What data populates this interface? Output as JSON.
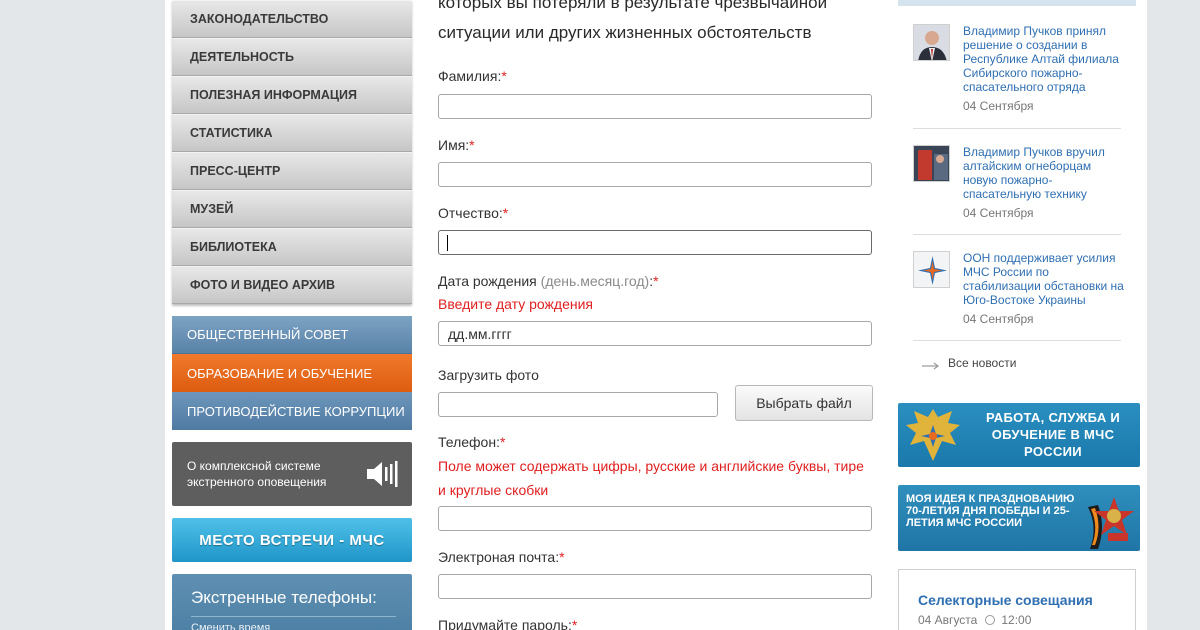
{
  "left_menu": {
    "gray_items": [
      {
        "label": "Законодательство"
      },
      {
        "label": "Деятельность"
      },
      {
        "label": "Полезная информация"
      },
      {
        "label": "Статистика"
      },
      {
        "label": "Пресс-центр"
      },
      {
        "label": "Музей"
      },
      {
        "label": "Библиотека"
      },
      {
        "label": "Фото и видео архив"
      }
    ],
    "color_items": [
      {
        "label": "Общественный совет"
      },
      {
        "label": "Образование и обучение"
      },
      {
        "label": "Противодействие коррупции"
      }
    ],
    "alert_system": {
      "text": "О комплексной системе экстренного оповещения",
      "icon": "speaker-icon"
    },
    "meeting_banner": {
      "text": "МЕСТО ВСТРЕЧИ - МЧС"
    },
    "emergency_phones": {
      "title": "Экстренные телефоны:",
      "subtitle": "Сменить время"
    }
  },
  "form": {
    "intro_line1": "которых вы потеряли в результате чрезвычайной",
    "intro_line2": "ситуации или других жизненных обстоятельств",
    "required_mark": "*",
    "surname": {
      "label": "Фамилия:",
      "value": ""
    },
    "name": {
      "label": "Имя:",
      "value": ""
    },
    "patronymic": {
      "label": "Отчество:",
      "value": ""
    },
    "birthdate": {
      "label": "Дата рождения",
      "hint": "(день.месяц.год)",
      "colon": ":",
      "error": "Введите дату рождения",
      "placeholder": "дд.мм.гггг"
    },
    "photo": {
      "label": "Загрузить фото",
      "button": "Выбрать файл"
    },
    "phone": {
      "label": "Телефон:",
      "error_line1": "Поле может содержать цифры, русские и английские буквы, тире",
      "error_line2": "и круглые скобки"
    },
    "email": {
      "label": "Электроная почта:"
    },
    "password": {
      "label": "Придумайте пароль:"
    }
  },
  "news": {
    "items": [
      {
        "title": "Владимир Пучков принял решение о создании в Республике Алтай филиала Сибирского пожарно-спасательного отряда",
        "date": "04 Сентября"
      },
      {
        "title": "Владимир Пучков вручил алтайским огнеборцам новую пожарно-спасательную технику",
        "date": "04 Сентября"
      },
      {
        "title": "ООН поддерживает усилия МЧС России по стабилизации обстановки на Юго-Востоке Украины",
        "date": "04 Сентября"
      }
    ],
    "all_news_label": "Все новости"
  },
  "banners": {
    "work_service": {
      "text": "РАБОТА, СЛУЖБА И ОБУЧЕНИЕ В МЧС РОССИИ"
    },
    "idea": {
      "text": "МОЯ ИДЕЯ К ПРАЗДНОВАНИЮ 70-ЛЕТИЯ ДНЯ ПОБЕДЫ И 25-ЛЕТИЯ МЧС РОССИИ"
    }
  },
  "meetings": {
    "title": "Селекторные совещания",
    "date": "04 Августа",
    "time": "12:00"
  },
  "colors": {
    "accent_orange": "#e8691f",
    "link_blue": "#2f6fb2",
    "error_red": "#e02020"
  }
}
